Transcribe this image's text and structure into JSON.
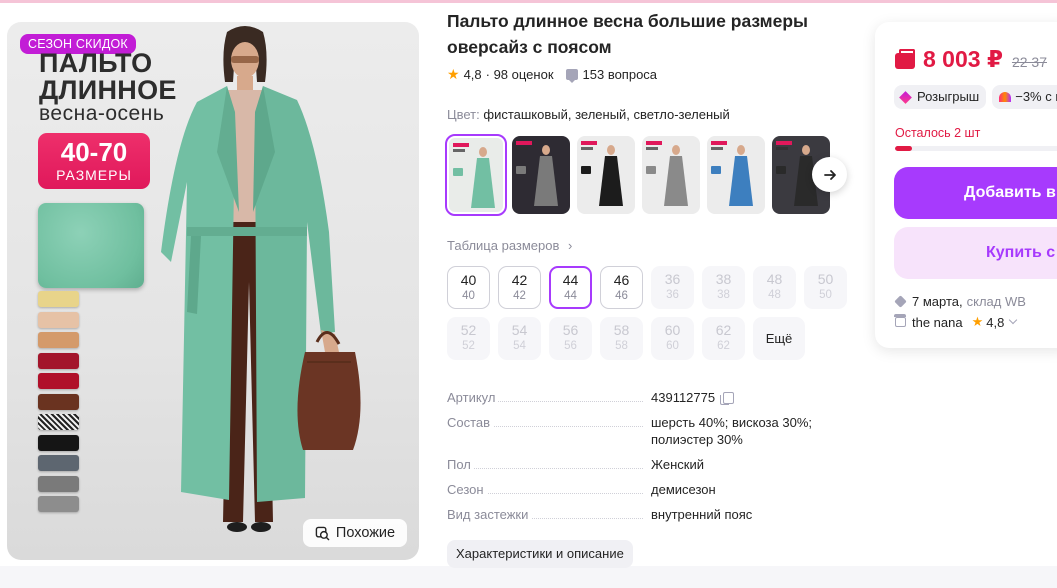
{
  "product": {
    "title": "Пальто длинное весна большие размеры оверсайз с поясом",
    "rating": "4,8",
    "reviews": "· 98 оценок",
    "questions": "153 вопроса"
  },
  "photo": {
    "season_badge": "СЕЗОН СКИДОК",
    "promo_title_line1": "ПАЛЬТО",
    "promo_title_line2": "ДЛИННОЕ",
    "promo_sub": "весна-осень",
    "promo_size_range": "40-70",
    "promo_size_word": "РАЗМЕРЫ",
    "similar_label": "Похожие",
    "swatch_colors": [
      "#e8d48a",
      "#e6c2a6",
      "#d49a6a",
      "#a3152b",
      "#b0102a",
      "#6a3320",
      "#cfcfcf",
      "#151515",
      "#5d6670",
      "#7a7a7a",
      "#8d8d8d"
    ]
  },
  "color": {
    "label": "Цвет:",
    "value": "фисташковый, зеленый, светло-зеленый",
    "thumbs": [
      {
        "name": "thumb-mint",
        "coat": "#72bfa3",
        "bg": "#e9ece9"
      },
      {
        "name": "thumb-gray-night",
        "coat": "#7a7a7a",
        "bg": "#2e2b33"
      },
      {
        "name": "thumb-black",
        "coat": "#1c1c1c",
        "bg": "#ececec"
      },
      {
        "name": "thumb-gray",
        "coat": "#8a8a8a",
        "bg": "#ececec"
      },
      {
        "name": "thumb-blue",
        "coat": "#3d7fbf",
        "bg": "#ececec"
      },
      {
        "name": "thumb-dark",
        "coat": "#2a2a2a",
        "bg": "#3b3a40"
      }
    ]
  },
  "sizes": {
    "table_link": "Таблица размеров",
    "items": [
      {
        "ru": "40",
        "eu": "40",
        "state": "avail"
      },
      {
        "ru": "42",
        "eu": "42",
        "state": "avail"
      },
      {
        "ru": "44",
        "eu": "44",
        "state": "selected"
      },
      {
        "ru": "46",
        "eu": "46",
        "state": "avail"
      },
      {
        "ru": "36",
        "eu": "36",
        "state": "na"
      },
      {
        "ru": "38",
        "eu": "38",
        "state": "na"
      },
      {
        "ru": "48",
        "eu": "48",
        "state": "na"
      },
      {
        "ru": "50",
        "eu": "50",
        "state": "na"
      },
      {
        "ru": "52",
        "eu": "52",
        "state": "na"
      },
      {
        "ru": "54",
        "eu": "54",
        "state": "na"
      },
      {
        "ru": "56",
        "eu": "56",
        "state": "na"
      },
      {
        "ru": "58",
        "eu": "58",
        "state": "na"
      },
      {
        "ru": "60",
        "eu": "60",
        "state": "na"
      },
      {
        "ru": "62",
        "eu": "62",
        "state": "na"
      }
    ],
    "more_label": "Ещё"
  },
  "specs": [
    {
      "name": "Артикул",
      "value": "439112775",
      "copy": true
    },
    {
      "name": "Состав",
      "value": "шерсть 40%; вискоза 30%; полиэстер 30%"
    },
    {
      "name": "Пол",
      "value": "Женский"
    },
    {
      "name": "Сезон",
      "value": "демисезон"
    },
    {
      "name": "Вид застежки",
      "value": "внутренний пояс"
    }
  ],
  "specs_button": "Характеристики и описание",
  "buy": {
    "price": "8 003 ₽",
    "old_price": "22 37",
    "chip_raffle": "Розыгрыш",
    "chip_discount": "−3% с к",
    "left_text": "Осталось 2 шт",
    "left_fraction": 0.09,
    "cart_button": "Добавить в",
    "buy_button": "Купить с",
    "delivery_date": "7 марта,",
    "delivery_place": "склад WB",
    "seller_name": "the nana",
    "seller_rating": "4,8"
  },
  "colors": {
    "accent": "#a73afd",
    "price_red": "#e11a44",
    "badge_purple": "#c21dd6",
    "star": "#ff9f00",
    "coat_mint": "#72bfa3"
  }
}
